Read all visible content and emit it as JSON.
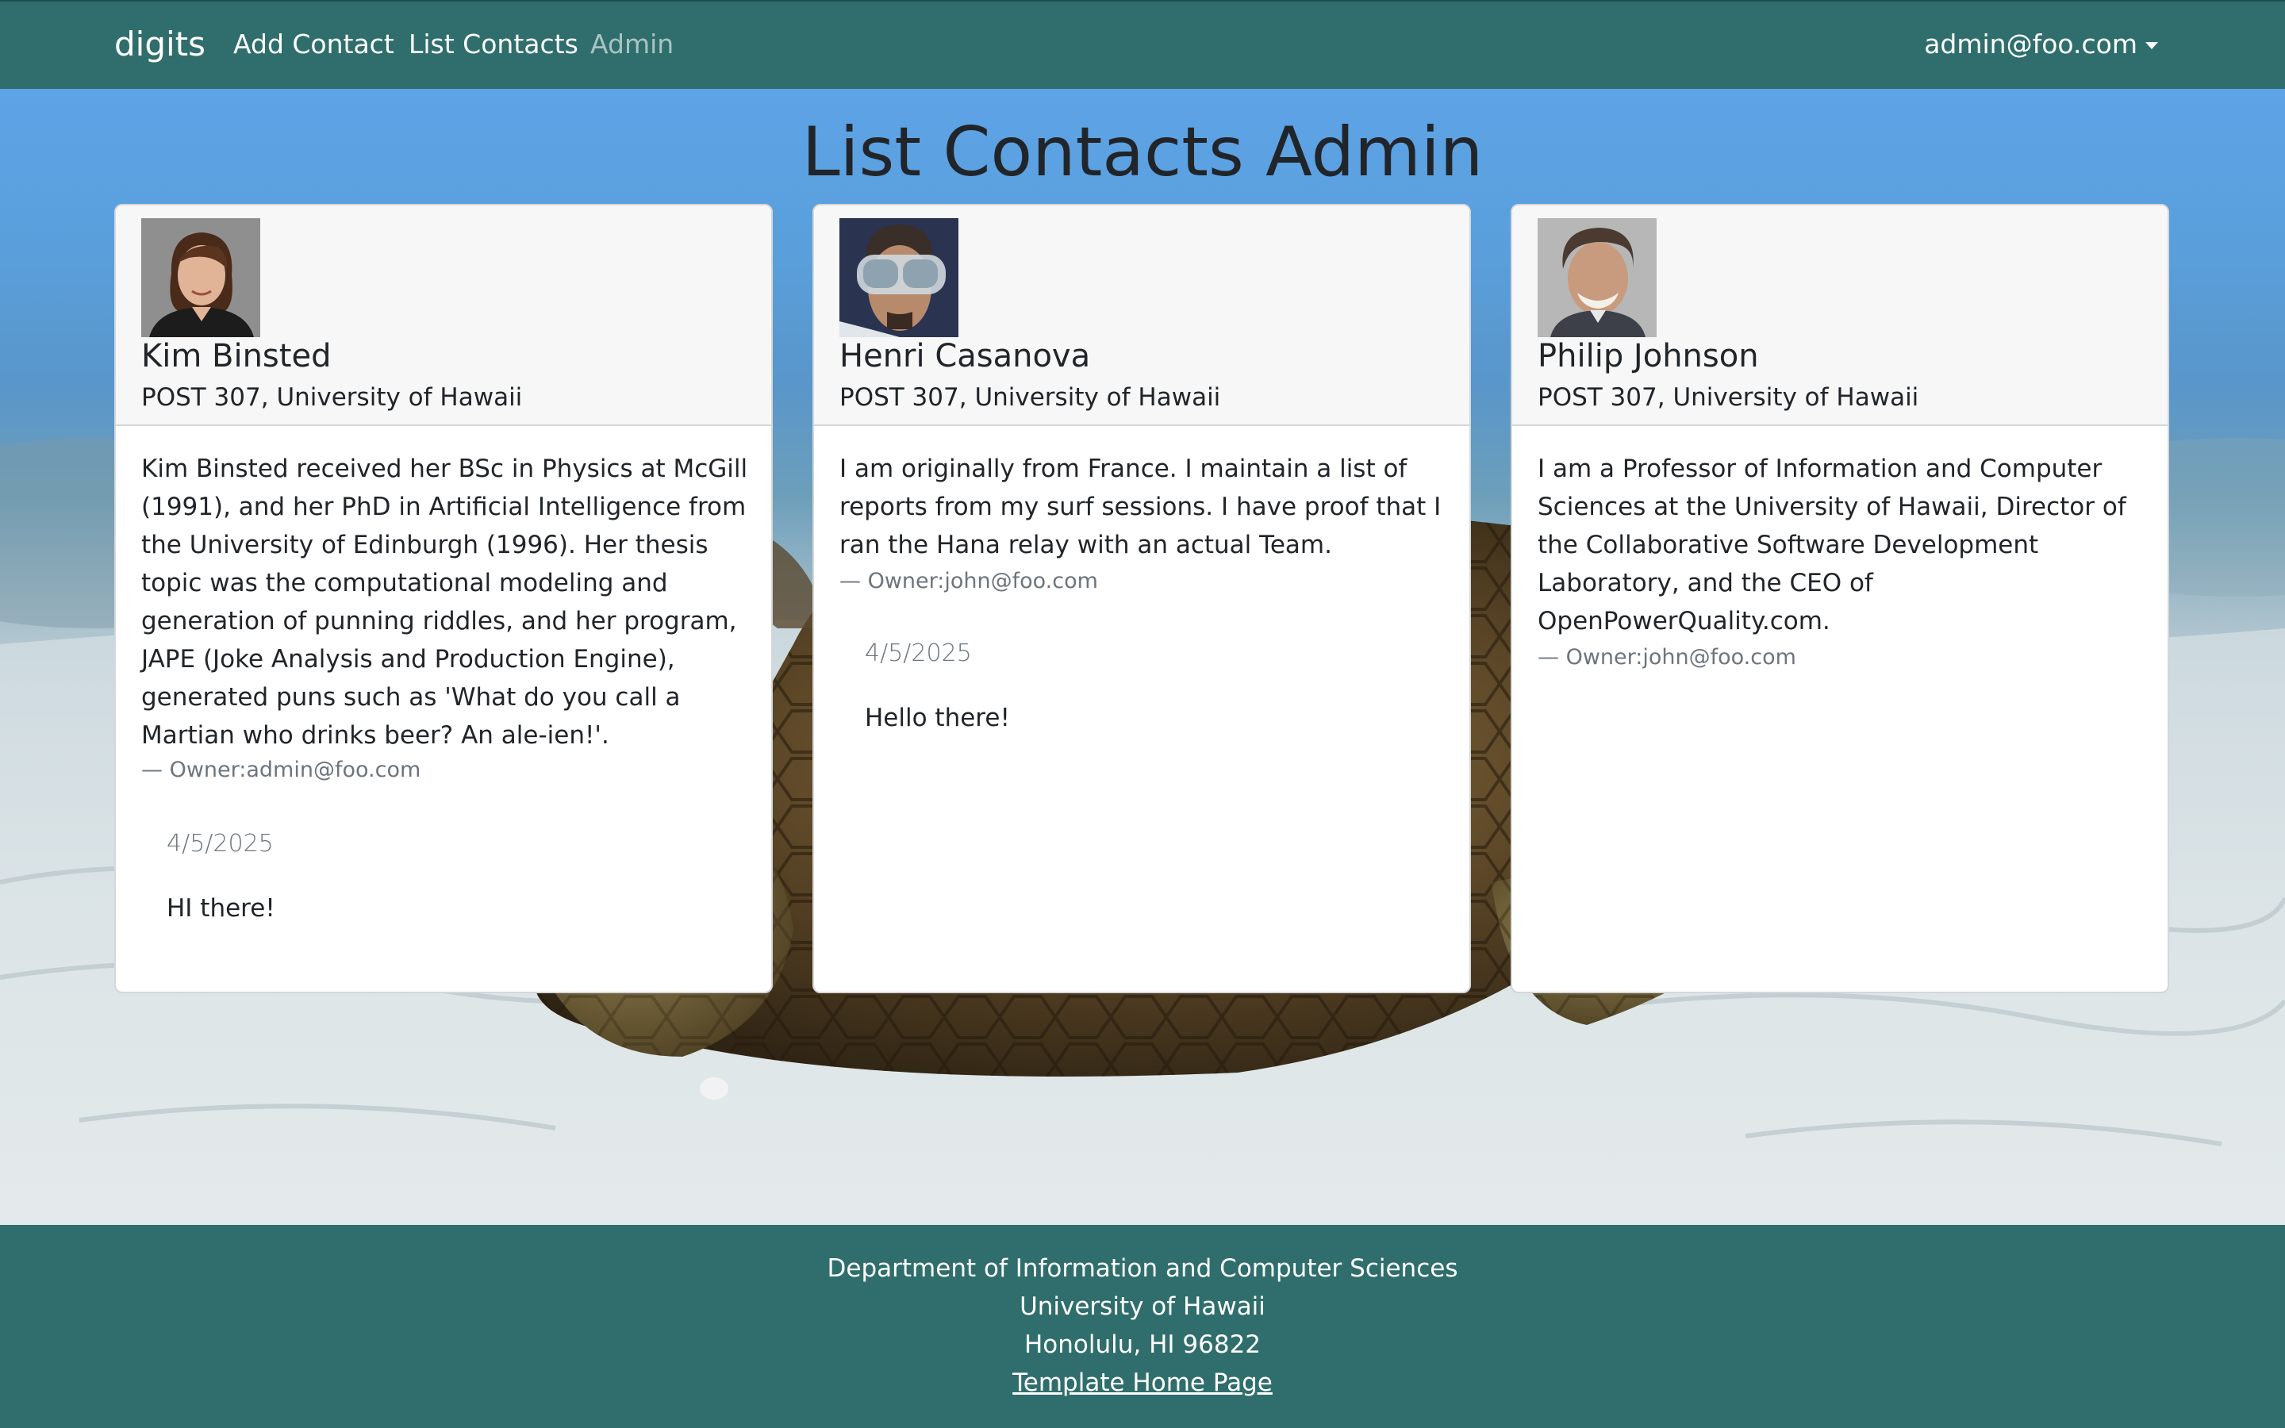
{
  "navbar": {
    "brand": "digits",
    "links": [
      "Add Contact",
      "List Contacts",
      "Admin"
    ],
    "user": "admin@foo.com"
  },
  "page": {
    "title": "List Contacts Admin"
  },
  "contacts": [
    {
      "name": "Kim Binsted",
      "address": "POST 307, University of Hawaii",
      "description": "Kim Binsted received her BSc in Physics at McGill (1991), and her PhD in Artificial Intelligence from the University of Edinburgh (1996). Her thesis topic was the computational modeling and generation of punning riddles, and her program, JAPE (Joke Analysis and Production Engine), generated puns such as 'What do you call a Martian who drinks beer? An ale-ien!'.",
      "owner": "— Owner:admin@foo.com",
      "note": {
        "date": "4/5/2025",
        "text": "HI there!"
      }
    },
    {
      "name": "Henri Casanova",
      "address": "POST 307, University of Hawaii",
      "description": "I am originally from France. I maintain a list of reports from my surf sessions. I have proof that I ran the Hana relay with an actual Team.",
      "owner": "— Owner:john@foo.com",
      "note": {
        "date": "4/5/2025",
        "text": "Hello there!"
      }
    },
    {
      "name": "Philip Johnson",
      "address": "POST 307, University of Hawaii",
      "description": "I am a Professor of Information and Computer Sciences at the University of Hawaii, Director of the Collaborative Software Development Laboratory, and the CEO of OpenPowerQuality.com.",
      "owner": "— Owner:john@foo.com"
    }
  ],
  "footer": {
    "lines": [
      "Department of Information and Computer Sciences",
      "University of Hawaii",
      "Honolulu, HI 96822"
    ],
    "link": "Template Home Page"
  },
  "colors": {
    "navbar": "#2f6e6c",
    "footer": "#2f6e6c",
    "card_header": "#f7f7f7"
  }
}
